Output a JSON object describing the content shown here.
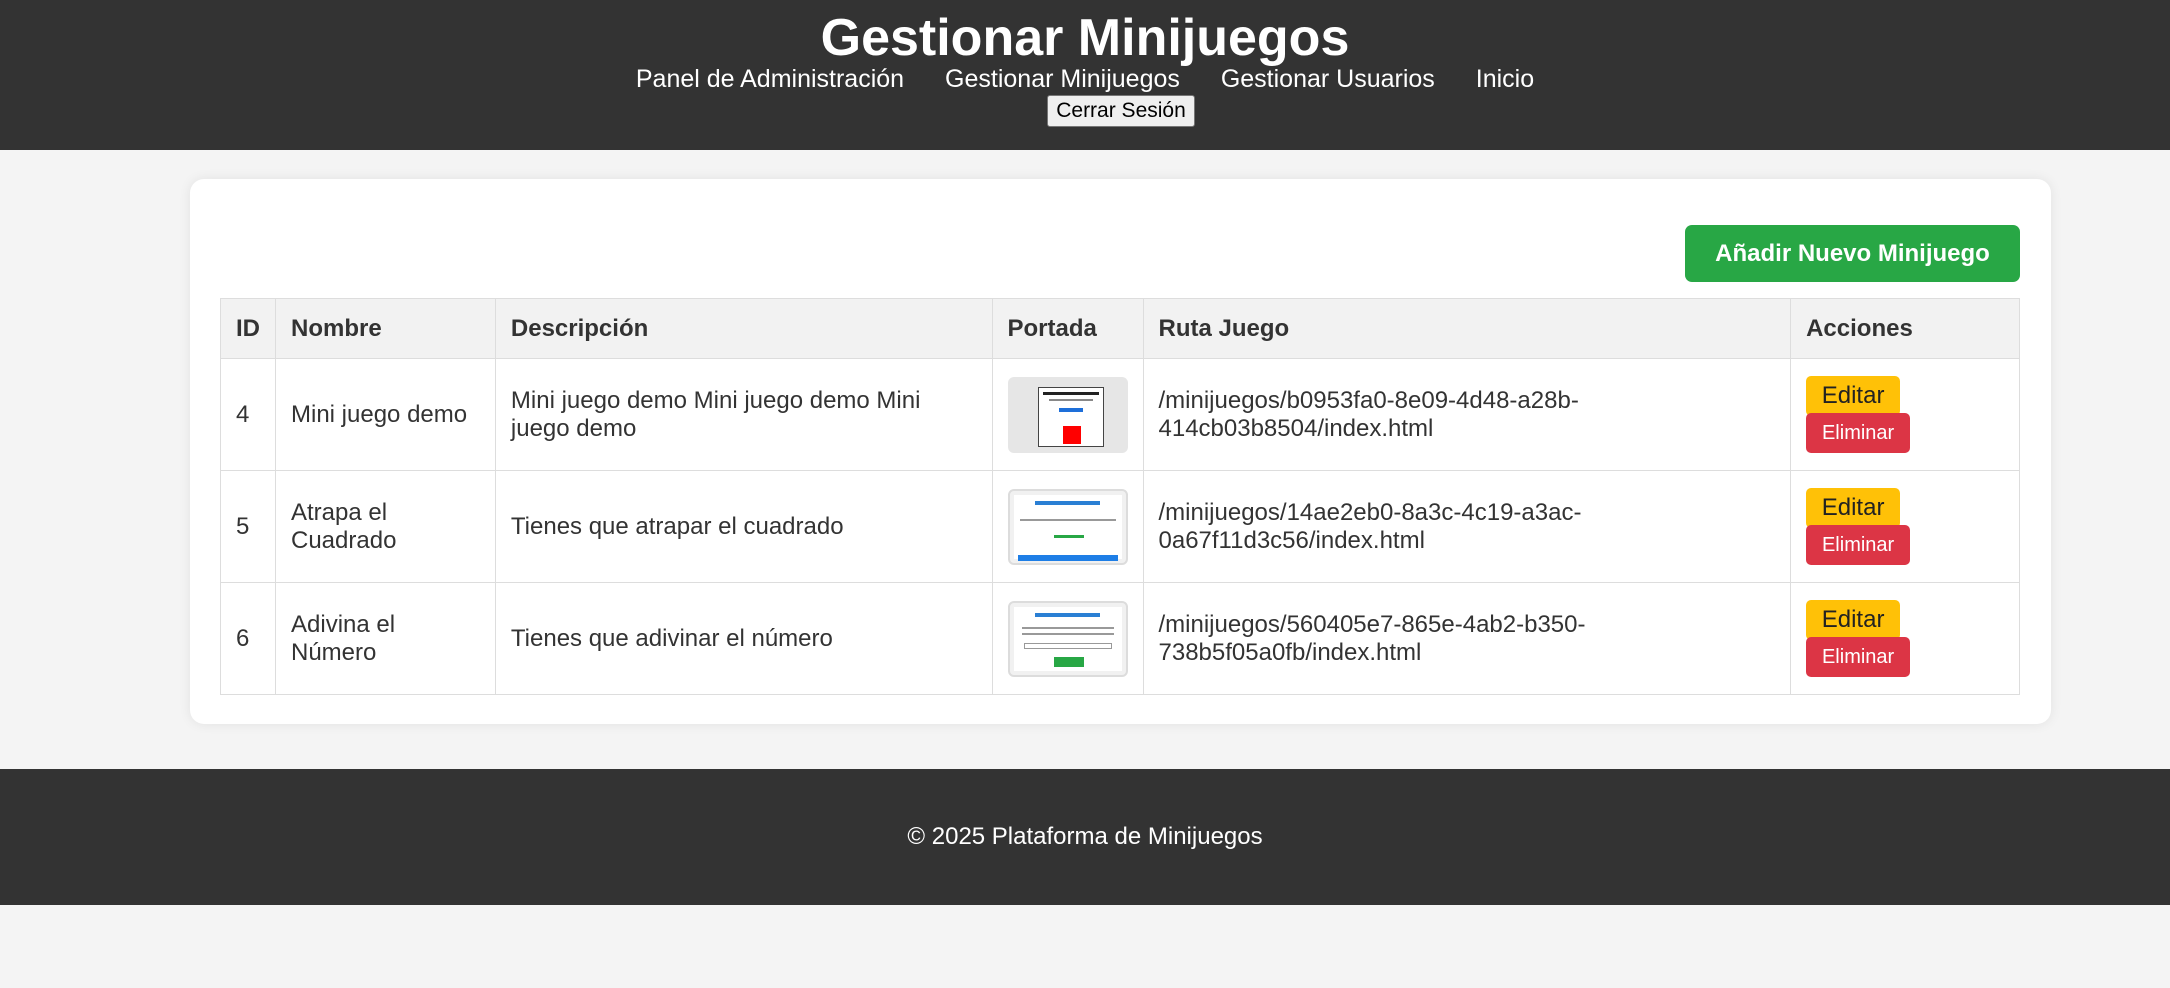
{
  "header": {
    "title": "Gestionar Minijuegos",
    "nav": [
      "Panel de Administración",
      "Gestionar Minijuegos",
      "Gestionar Usuarios",
      "Inicio"
    ],
    "logout_label": "Cerrar Sesión"
  },
  "main": {
    "add_button_label": "Añadir Nuevo Minijuego",
    "table": {
      "headers": [
        "ID",
        "Nombre",
        "Descripción",
        "Portada",
        "Ruta Juego",
        "Acciones"
      ],
      "rows": [
        {
          "id": "4",
          "nombre": "Mini juego demo",
          "descripcion": "Mini juego demo Mini juego demo Mini juego demo",
          "ruta": "/minijuegos/b0953fa0-8e09-4d48-a28b-414cb03b8504/index.html"
        },
        {
          "id": "5",
          "nombre": "Atrapa el Cuadrado",
          "descripcion": "Tienes que atrapar el cuadrado",
          "ruta": "/minijuegos/14ae2eb0-8a3c-4c19-a3ac-0a67f11d3c56/index.html"
        },
        {
          "id": "6",
          "nombre": "Adivina el Número",
          "descripcion": "Tienes que adivinar el número",
          "ruta": "/minijuegos/560405e7-865e-4ab2-b350-738b5f05a0fb/index.html"
        }
      ],
      "edit_label": "Editar",
      "delete_label": "Eliminar"
    }
  },
  "footer": {
    "text": "© 2025 Plataforma de Minijuegos"
  },
  "colors": {
    "header_bg": "#333333",
    "add_button": "#28a745",
    "edit_button": "#ffc107",
    "delete_button": "#dc3545"
  }
}
